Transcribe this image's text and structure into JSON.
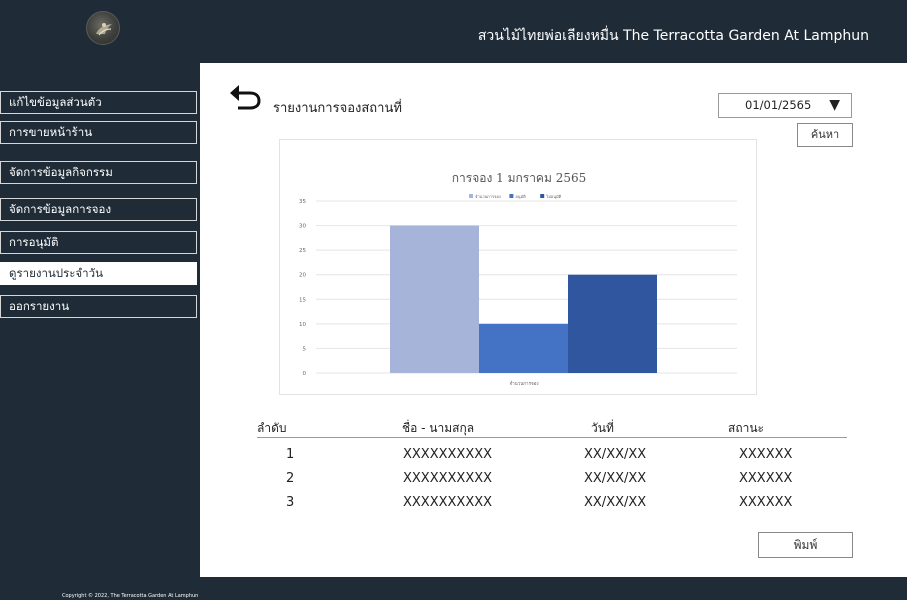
{
  "header": {
    "title": "สวนไม้ไทยพ่อเลียงหมื่น  The Terracotta Garden At Lamphun",
    "logo_icon": "garden-logo"
  },
  "sidebar": {
    "items": [
      {
        "label": "แก้ไขข้อมูลส่วนตัว",
        "active": false
      },
      {
        "label": "การขายหน้าร้าน",
        "active": false
      },
      {
        "label": "จัดการข้อมูลกิจกรรม",
        "active": false
      },
      {
        "label": "จัดการข้อมูลการจอง",
        "active": false
      },
      {
        "label": "การอนุมัติ",
        "active": false
      },
      {
        "label": "ดูรายงานประจำวัน",
        "active": true
      },
      {
        "label": "ออกรายงาน",
        "active": false
      }
    ]
  },
  "main": {
    "back_icon": "back-arrow-icon",
    "heading": "รายงานการจองสถานที่",
    "date_select": {
      "value": "01/01/2565",
      "arrow": "▼"
    },
    "search_label": "ค้นหา",
    "print_label": "พิมพ์"
  },
  "chart_data": {
    "type": "bar",
    "title": "การจอง 1 มกราคม 2565",
    "categories": [
      "จำนวนการจอง"
    ],
    "series": [
      {
        "name": "จำนวนการจอง",
        "values": [
          30
        ],
        "color": "#a5b4d8"
      },
      {
        "name": "อนุมัติ",
        "values": [
          10
        ],
        "color": "#4472c4"
      },
      {
        "name": "ไม่อนุมัติ",
        "values": [
          20
        ],
        "color": "#2f569f"
      }
    ],
    "ylim": [
      0,
      35
    ],
    "yticks": [
      "0",
      "5",
      "10",
      "15",
      "20",
      "25",
      "30",
      "35"
    ],
    "grid": true,
    "legend": "top-center"
  },
  "table": {
    "headers": [
      "ลำดับ",
      "ชื่อ - นามสกุล",
      "วันที่",
      "สถานะ"
    ],
    "rows": [
      [
        "1",
        "XXXXXXXXXX",
        "XX/XX/XX",
        "XXXXXX"
      ],
      [
        "2",
        "XXXXXXXXXX",
        "XX/XX/XX",
        "XXXXXX"
      ],
      [
        "3",
        "XXXXXXXXXX",
        "XX/XX/XX",
        "XXXXXX"
      ]
    ]
  },
  "footer": {
    "copyright": "Copyright © 2022, The Terracotta Garden At Lamphun"
  }
}
